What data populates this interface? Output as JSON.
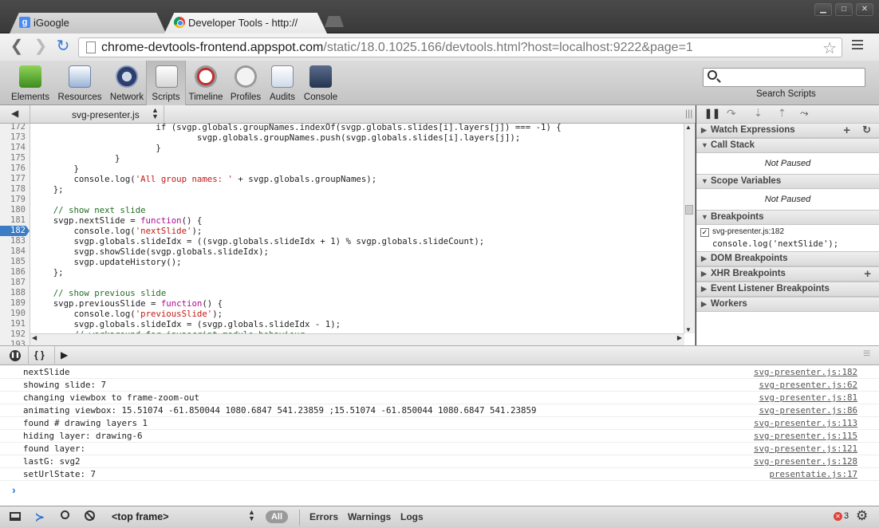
{
  "window": {
    "tabs": [
      {
        "title": "iGoogle"
      },
      {
        "title": "Developer Tools - http://"
      }
    ],
    "controls": [
      "minimize",
      "maximize",
      "close"
    ]
  },
  "address_bar": {
    "host": "chrome-devtools-frontend.appspot.com",
    "path": "/static/18.0.1025.166/devtools.html?host=localhost:9222&page=1"
  },
  "toolbar": {
    "panels": [
      "Elements",
      "Resources",
      "Network",
      "Scripts",
      "Timeline",
      "Profiles",
      "Audits",
      "Console"
    ],
    "selected": "Scripts",
    "search_label": "Search Scripts"
  },
  "scripts": {
    "file": "svg-presenter.js",
    "breakpoint_line": "182",
    "lines": [
      {
        "n": "172",
        "text": "                        if (svgp.globals.groupNames.indexOf(svgp.globals.slides[i].layers[j]) === -1) {"
      },
      {
        "n": "173",
        "text": "                                svgp.globals.groupNames.push(svgp.globals.slides[i].layers[j]);"
      },
      {
        "n": "174",
        "text": "                        }"
      },
      {
        "n": "175",
        "text": "                }"
      },
      {
        "n": "176",
        "text": "        }"
      },
      {
        "n": "177",
        "pre": "        console.log(",
        "str": "'All group names: '",
        "post": " + svgp.globals.groupNames);"
      },
      {
        "n": "178",
        "text": "    };"
      },
      {
        "n": "179",
        "text": ""
      },
      {
        "n": "180",
        "comment": "    // show next slide"
      },
      {
        "n": "181",
        "pre": "    svgp.nextSlide = ",
        "kw": "function",
        "post": "() {"
      },
      {
        "n": "182",
        "pre": "        console.log(",
        "str": "'nextSlide'",
        "post": ");"
      },
      {
        "n": "183",
        "text": "        svgp.globals.slideIdx = ((svgp.globals.slideIdx + 1) % svgp.globals.slideCount);"
      },
      {
        "n": "184",
        "text": "        svgp.showSlide(svgp.globals.slideIdx);"
      },
      {
        "n": "185",
        "text": "        svgp.updateHistory();"
      },
      {
        "n": "186",
        "text": "    };"
      },
      {
        "n": "187",
        "text": ""
      },
      {
        "n": "188",
        "comment": "    // show previous slide"
      },
      {
        "n": "189",
        "pre": "    svgp.previousSlide = ",
        "kw": "function",
        "post": "() {"
      },
      {
        "n": "190",
        "pre": "        console.log(",
        "str": "'previousSlide'",
        "post": ");"
      },
      {
        "n": "191",
        "text": "        svgp.globals.slideIdx = (svgp.globals.slideIdx - 1);"
      },
      {
        "n": "192",
        "comment": "        // workaround for javascript module behaviour"
      },
      {
        "n": "193",
        "text": ""
      }
    ]
  },
  "sidebar": {
    "watch": "Watch Expressions",
    "call_stack": "Call Stack",
    "call_stack_value": "Not Paused",
    "scope": "Scope Variables",
    "scope_value": "Not Paused",
    "breakpoints": "Breakpoints",
    "bp_location": "svg-presenter.js:182",
    "bp_code": "console.log('nextSlide');",
    "dom": "DOM Breakpoints",
    "xhr": "XHR Breakpoints",
    "event": "Event Listener Breakpoints",
    "workers": "Workers"
  },
  "console": {
    "messages": [
      {
        "text": "nextSlide",
        "source": "svg-presenter.js:182"
      },
      {
        "text": "showing slide: 7",
        "source": "svg-presenter.js:62"
      },
      {
        "text": "changing viewbox to frame-zoom-out",
        "source": "svg-presenter.js:81"
      },
      {
        "text": "animating viewbox: 15.51074 -61.850044 1080.6847 541.23859 ;15.51074 -61.850044 1080.6847 541.23859",
        "source": "svg-presenter.js:86"
      },
      {
        "text": "found # drawing layers 1",
        "source": "svg-presenter.js:113"
      },
      {
        "text": "hiding layer: drawing-6",
        "source": "svg-presenter.js:115"
      },
      {
        "text": "found layer:",
        "source": "svg-presenter.js:121"
      },
      {
        "text": "lastG: svg2",
        "source": "svg-presenter.js:128"
      },
      {
        "text": "setUrlState: 7",
        "source": "presentatie.js:17"
      }
    ],
    "prompt": "›"
  },
  "statusbar": {
    "frame": "<top frame>",
    "filters": [
      "All",
      "Errors",
      "Warnings",
      "Logs"
    ],
    "error_count": "3"
  }
}
